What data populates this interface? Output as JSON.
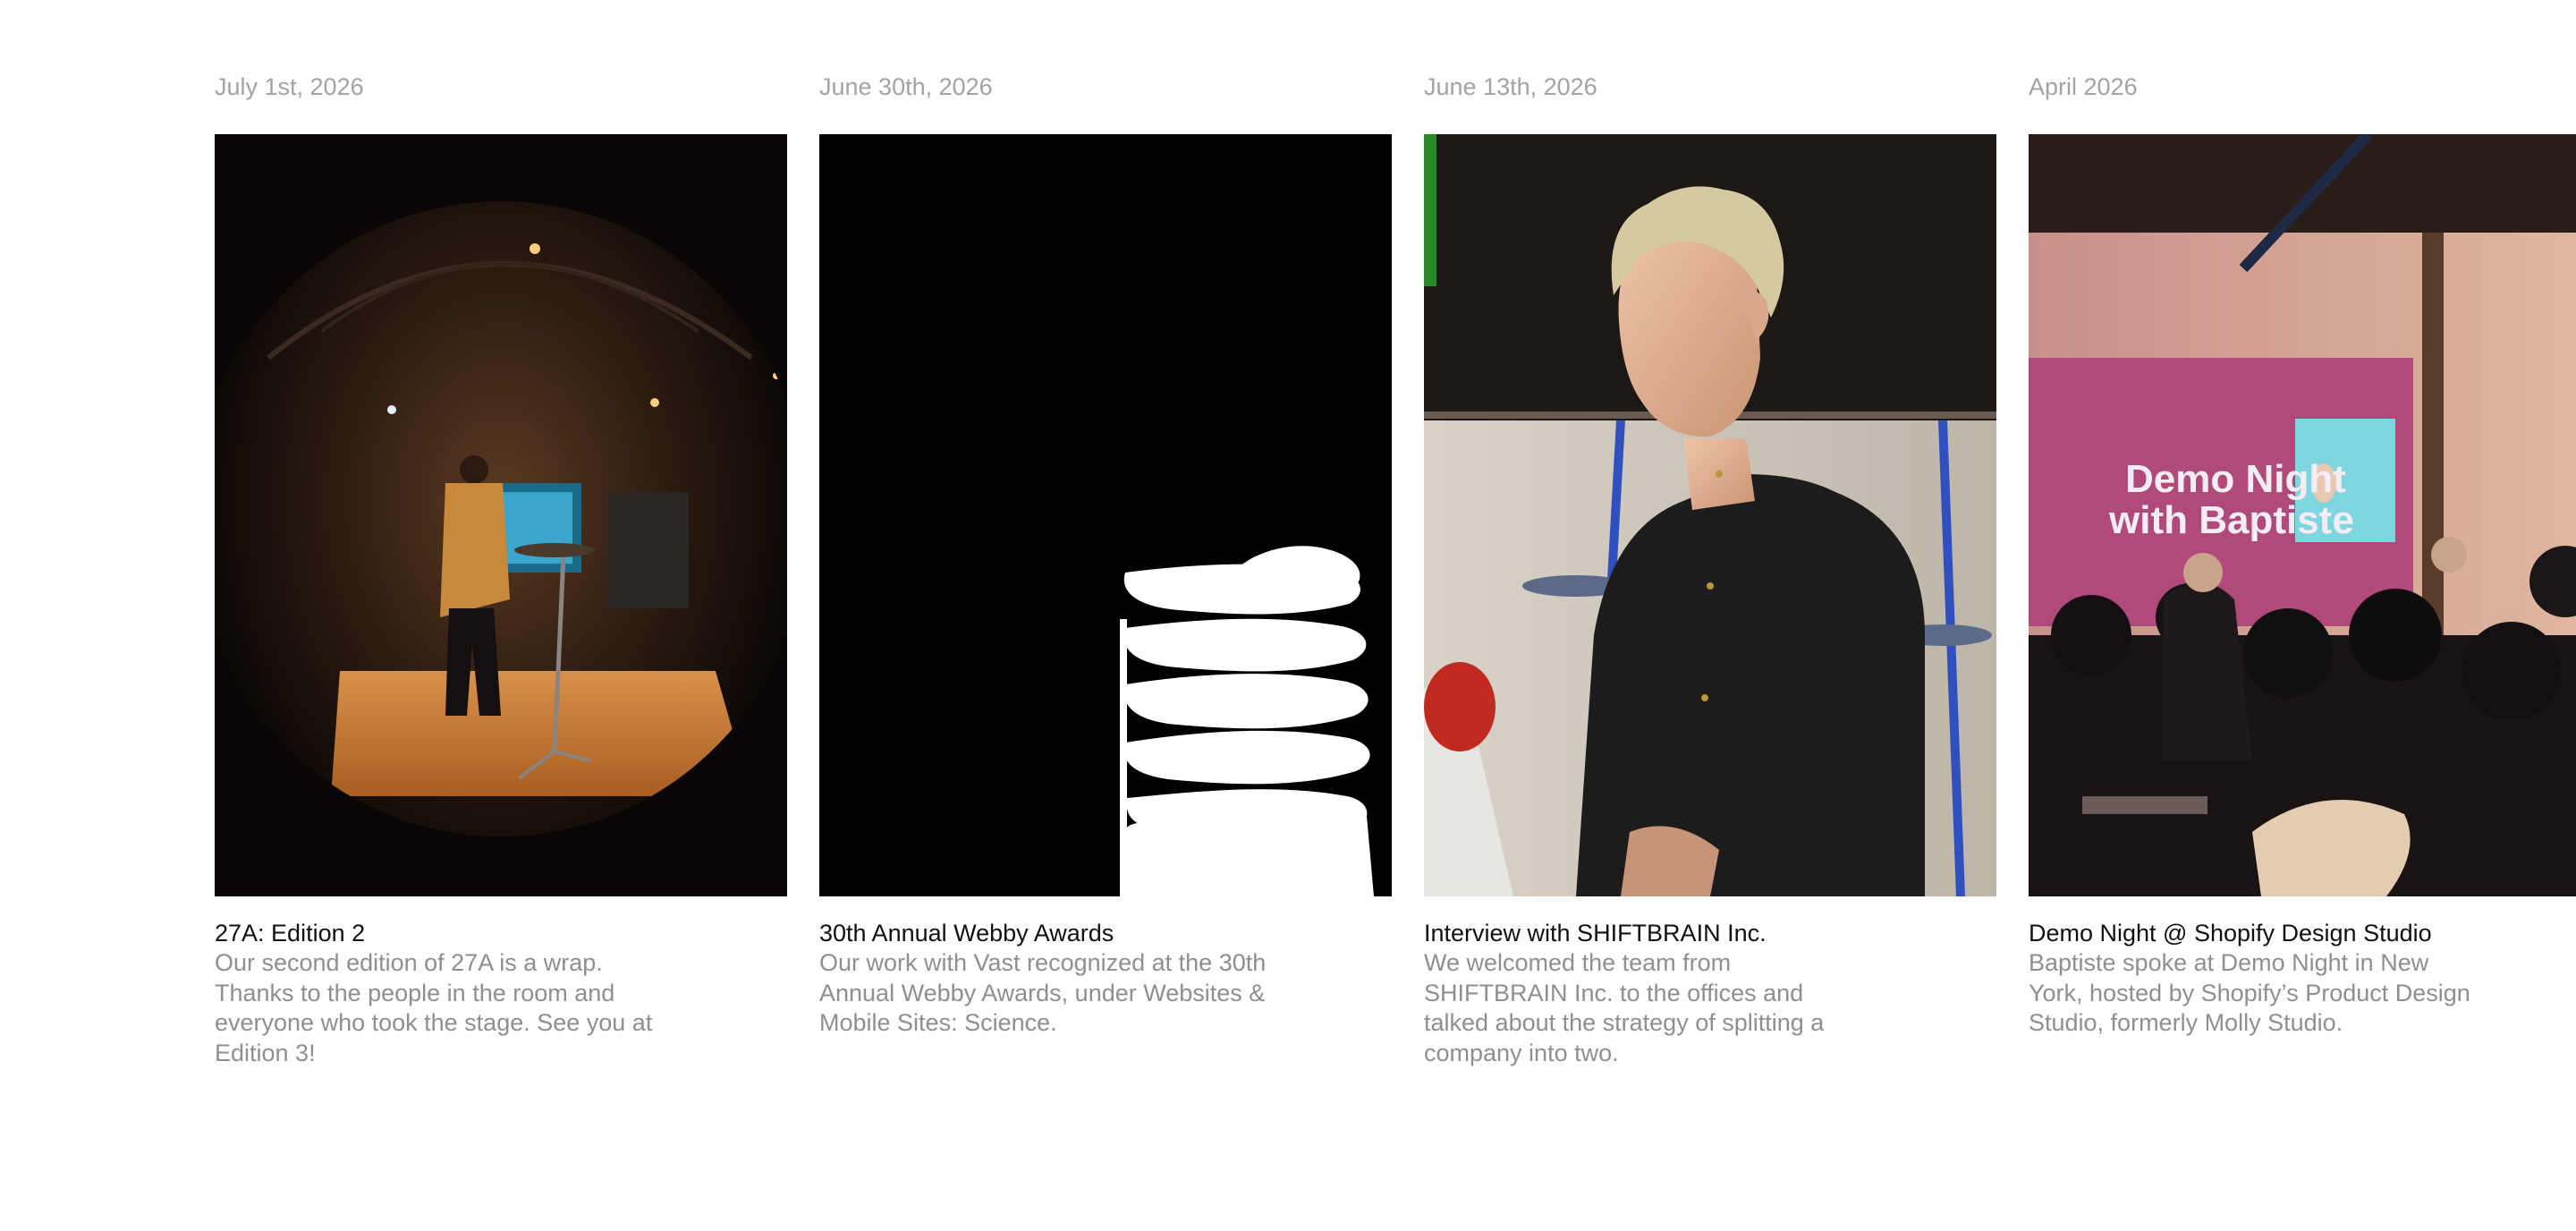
{
  "posts": [
    {
      "date": "July 1st, 2026",
      "title": "27A: Edition 2",
      "description": "Our second edition of 27A is a wrap. Thanks to the people in the room and everyone who took the stage. See you at Edition 3!",
      "image": "fisheye-stage-speaker-photo"
    },
    {
      "date": "June 30th, 2026",
      "title": "30th Annual Webby Awards",
      "description": "Our work with Vast recognized at the 30th Annual Webby Awards, under Websites & Mobile Sites: Science.",
      "image": "webby-spring-logo"
    },
    {
      "date": "June 13th, 2026",
      "title": "Interview with SHIFTBRAIN Inc.",
      "description": "We welcomed the team from SHIFTBRAIN Inc. to the offices and talked about the strategy of splitting a company into two.",
      "image": "interview-portrait-photo"
    },
    {
      "date": "April 2026",
      "title": "Demo Night @ Shopify Design Studio",
      "description": "Baptiste spoke at Demo Night in New York, hosted by Shopify’s Product Design Studio, formerly Molly Studio.",
      "image": "demo-night-event-photo",
      "projected_text": "Demo Night with Baptiste"
    }
  ]
}
